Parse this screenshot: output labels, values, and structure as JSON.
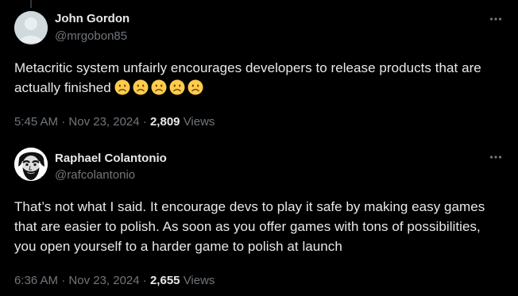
{
  "colors": {
    "background": "#000000",
    "text_primary": "#e7e9ea",
    "text_secondary": "#71767b",
    "avatar_placeholder": "#cfd9de",
    "emoji_yellow": "#ffcc4d"
  },
  "tweets": [
    {
      "author_name": "John Gordon",
      "handle": "@mrgobon85",
      "avatar": "default-profile-icon",
      "text": "Metacritic system unfairly encourages developers to release products that are actually finished",
      "emojis": [
        "slightly-frowning-face",
        "slightly-frowning-face",
        "slightly-frowning-face",
        "slightly-frowning-face",
        "slightly-frowning-face"
      ],
      "time": "5:45 AM",
      "separator": "·",
      "date": "Nov 23, 2024",
      "views_count": "2,809",
      "views_label": "Views",
      "more_icon": "more-horizontal-icon"
    },
    {
      "author_name": "Raphael Colantonio",
      "handle": "@rafcolantonio",
      "avatar": "bearded-portrait-avatar",
      "text": "That’s not what I said. It encourage devs to play it safe by making easy games that are easier to polish. As soon as you offer games with tons of possibilities, you open yourself to a harder game to polish at launch",
      "time": "6:36 AM",
      "separator": "·",
      "date": "Nov 23, 2024",
      "views_count": "2,655",
      "views_label": "Views",
      "more_icon": "more-horizontal-icon"
    }
  ]
}
